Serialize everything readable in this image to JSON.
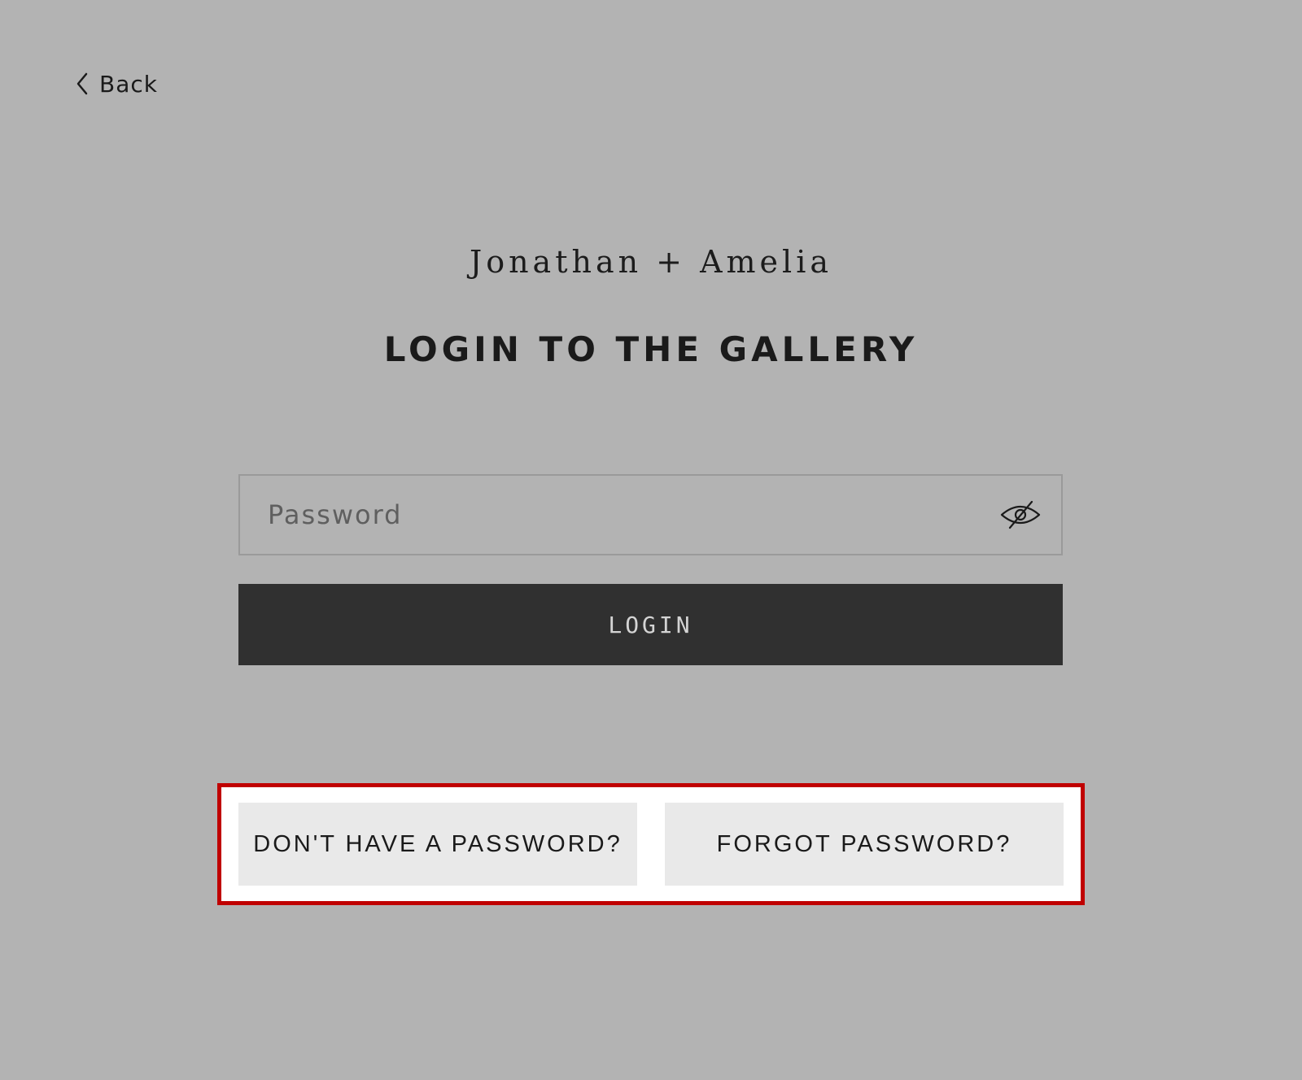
{
  "nav": {
    "back_label": "Back",
    "back_icon": "chevron-left-icon"
  },
  "header": {
    "couple_name": "Jonathan + Amelia",
    "title": "LOGIN TO THE GALLERY"
  },
  "form": {
    "password_value": "",
    "password_placeholder": "Password",
    "visibility_icon": "eye-off-icon",
    "login_label": "LOGIN"
  },
  "help": {
    "no_password_label": "DON'T HAVE A PASSWORD?",
    "forgot_label": "FORGOT PASSWORD?",
    "highlight_color": "#c00000"
  },
  "colors": {
    "background": "#b3b3b3",
    "login_button": "#303030",
    "help_button": "#e9e9e9"
  }
}
